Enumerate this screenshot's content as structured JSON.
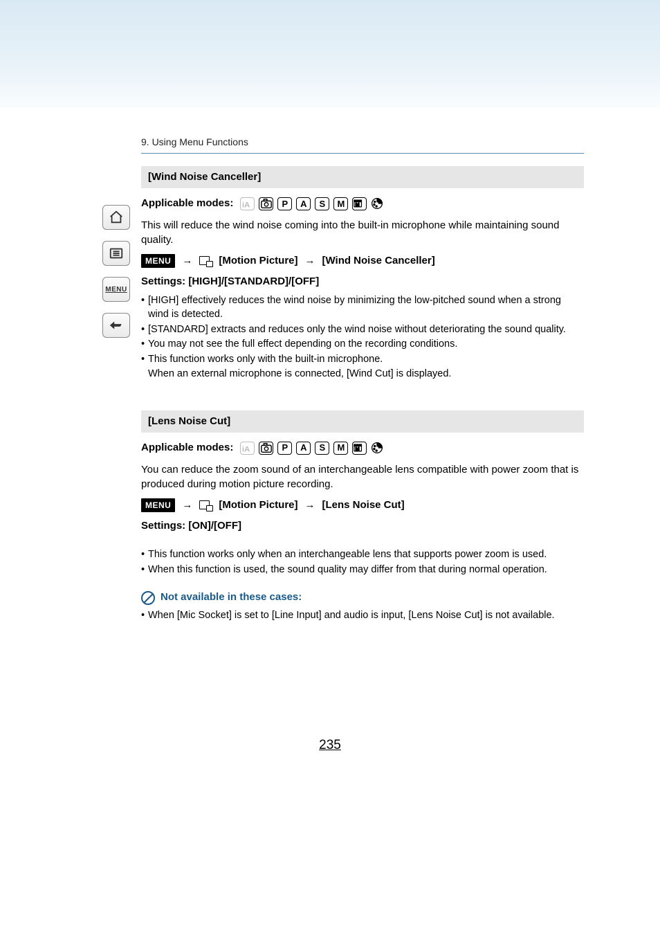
{
  "page": {
    "breadcrumb": "9. Using Menu Functions",
    "number": "235"
  },
  "sidebar": {
    "home": "home-icon",
    "list": "list-icon",
    "menu_label": "MENU",
    "back": "back-icon"
  },
  "section1": {
    "title": "[Wind Noise Canceller]",
    "applicable_label": "Applicable modes:",
    "modes": {
      "ia_disabled": "iA",
      "camera": "camera",
      "p": "P",
      "a": "A",
      "s": "S",
      "m": "M",
      "movie_m": "M",
      "palette": "palette"
    },
    "intro": "This will reduce the wind noise coming into the built-in microphone while maintaining sound quality.",
    "menu_badge": "MENU",
    "arrow": "→",
    "path_motion": "[Motion Picture]",
    "path_target": "[Wind Noise Canceller]",
    "settings": "Settings: [HIGH]/[STANDARD]/[OFF]",
    "bullets": [
      "[HIGH] effectively reduces the wind noise by minimizing the low-pitched sound when a strong wind is detected.",
      "[STANDARD] extracts and reduces only the wind noise without deteriorating the sound quality.",
      "You may not see the full effect depending on the recording conditions.",
      "This function works only with the built-in microphone."
    ],
    "bullet_sub": "When an external microphone is connected, [Wind Cut] is displayed."
  },
  "section2": {
    "title": "[Lens Noise Cut]",
    "applicable_label": "Applicable modes:",
    "intro": "You can reduce the zoom sound of an interchangeable lens compatible with power zoom that is produced during motion picture recording.",
    "menu_badge": "MENU",
    "arrow": "→",
    "path_motion": "[Motion Picture]",
    "path_target": "[Lens Noise Cut]",
    "settings": "Settings: [ON]/[OFF]",
    "bullets": [
      "This function works only when an interchangeable lens that supports power zoom is used.",
      "When this function is used, the sound quality may differ from that during normal operation."
    ],
    "not_available_label": "Not available in these cases:",
    "not_available_bullets": [
      "When [Mic Socket] is set to [Line Input] and audio is input, [Lens Noise Cut] is not available."
    ]
  }
}
